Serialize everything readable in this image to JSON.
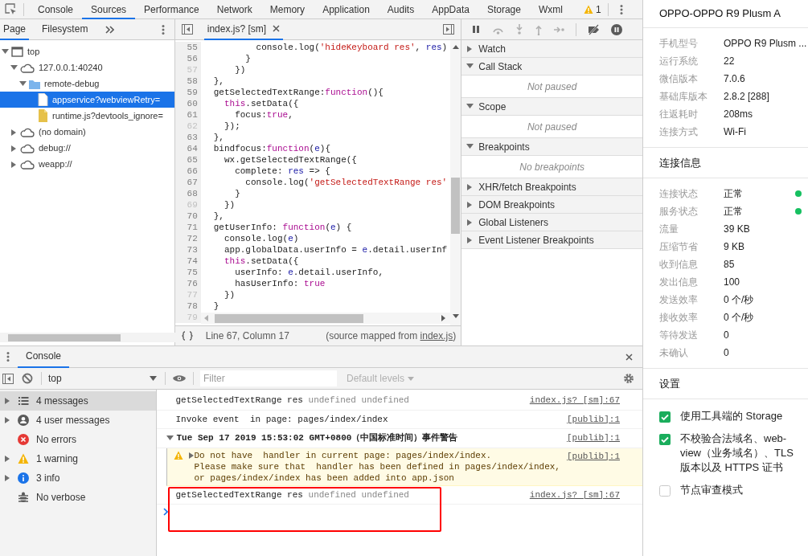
{
  "main_tabs": [
    {
      "label": "Console",
      "selected": false
    },
    {
      "label": "Sources",
      "selected": true
    },
    {
      "label": "Performance",
      "selected": false
    },
    {
      "label": "Network",
      "selected": false
    },
    {
      "label": "Memory",
      "selected": false
    },
    {
      "label": "Application",
      "selected": false
    },
    {
      "label": "Audits",
      "selected": false
    },
    {
      "label": "AppData",
      "selected": false
    },
    {
      "label": "Storage",
      "selected": false
    },
    {
      "label": "Wxml",
      "selected": false
    }
  ],
  "warning_count": "1",
  "navigator": {
    "tabs": [
      {
        "label": "Page",
        "selected": true
      },
      {
        "label": "Filesystem",
        "selected": false
      }
    ],
    "tree": [
      {
        "label": "top",
        "kind": "frame",
        "expanded": true,
        "selected": false,
        "children": [
          {
            "label": "127.0.0.1:40240",
            "kind": "domain",
            "expanded": true,
            "selected": false,
            "children": [
              {
                "label": "remote-debug",
                "kind": "folder",
                "expanded": true,
                "selected": false,
                "children": [
                  {
                    "label": "appservice?webviewRetry=",
                    "kind": "file",
                    "selected": true
                  },
                  {
                    "label": "runtime.js?devtools_ignore=",
                    "kind": "script",
                    "selected": false
                  }
                ]
              }
            ]
          },
          {
            "label": "(no domain)",
            "kind": "domain",
            "expanded": false,
            "selected": false
          },
          {
            "label": "debug://",
            "kind": "domain",
            "expanded": false,
            "selected": false
          },
          {
            "label": "weapp://",
            "kind": "domain",
            "expanded": false,
            "selected": false
          }
        ]
      }
    ]
  },
  "editor": {
    "tab": "index.js? [sm]",
    "lines": [
      {
        "number": "55",
        "dim": false,
        "code": [
          {
            "text": "        console.log(",
            "kind": "plain"
          },
          {
            "text": "'hideKeyboard res'",
            "kind": "string"
          },
          {
            "text": ", ",
            "kind": "plain"
          },
          {
            "text": "res",
            "kind": "variable"
          },
          {
            "text": ")",
            "kind": "plain"
          }
        ]
      },
      {
        "number": "56",
        "dim": false,
        "code": [
          {
            "text": "      }",
            "kind": "plain"
          }
        ]
      },
      {
        "number": "57",
        "dim": true,
        "code": [
          {
            "text": "    })",
            "kind": "plain"
          }
        ]
      },
      {
        "number": "58",
        "dim": false,
        "code": [
          {
            "text": "},",
            "kind": "plain"
          }
        ]
      },
      {
        "number": "59",
        "dim": false,
        "code": [
          {
            "text": "getSelectedTextRange:",
            "kind": "plain"
          },
          {
            "text": "function",
            "kind": "keyword"
          },
          {
            "text": "(){",
            "kind": "plain"
          }
        ]
      },
      {
        "number": "60",
        "dim": false,
        "code": [
          {
            "text": "  this",
            "kind": "keyword"
          },
          {
            "text": ".setData({",
            "kind": "plain"
          }
        ]
      },
      {
        "number": "61",
        "dim": false,
        "code": [
          {
            "text": "    focus:",
            "kind": "plain"
          },
          {
            "text": "true",
            "kind": "keyword"
          },
          {
            "text": ",",
            "kind": "plain"
          }
        ]
      },
      {
        "number": "62",
        "dim": true,
        "code": [
          {
            "text": "  });",
            "kind": "plain"
          }
        ]
      },
      {
        "number": "63",
        "dim": false,
        "code": [
          {
            "text": "},",
            "kind": "plain"
          }
        ]
      },
      {
        "number": "64",
        "dim": false,
        "code": [
          {
            "text": "bindfocus:",
            "kind": "plain"
          },
          {
            "text": "function",
            "kind": "keyword"
          },
          {
            "text": "(",
            "kind": "plain"
          },
          {
            "text": "e",
            "kind": "variable"
          },
          {
            "text": "){",
            "kind": "plain"
          }
        ]
      },
      {
        "number": "65",
        "dim": false,
        "code": [
          {
            "text": "  wx.getSelectedTextRange({",
            "kind": "plain"
          }
        ]
      },
      {
        "number": "66",
        "dim": false,
        "code": [
          {
            "text": "    complete: ",
            "kind": "plain"
          },
          {
            "text": "res",
            "kind": "variable"
          },
          {
            "text": " => {",
            "kind": "plain"
          }
        ]
      },
      {
        "number": "67",
        "dim": false,
        "code": [
          {
            "text": "      console.log(",
            "kind": "plain"
          },
          {
            "text": "'getSelectedTextRange res'",
            "kind": "string"
          }
        ]
      },
      {
        "number": "68",
        "dim": false,
        "code": [
          {
            "text": "    }",
            "kind": "plain"
          }
        ]
      },
      {
        "number": "69",
        "dim": true,
        "code": [
          {
            "text": "  })",
            "kind": "plain"
          }
        ]
      },
      {
        "number": "70",
        "dim": false,
        "code": [
          {
            "text": "},",
            "kind": "plain"
          }
        ]
      },
      {
        "number": "71",
        "dim": false,
        "code": [
          {
            "text": "getUserInfo: ",
            "kind": "plain"
          },
          {
            "text": "function",
            "kind": "keyword"
          },
          {
            "text": "(",
            "kind": "plain"
          },
          {
            "text": "e",
            "kind": "variable"
          },
          {
            "text": ") {",
            "kind": "plain"
          }
        ]
      },
      {
        "number": "72",
        "dim": false,
        "code": [
          {
            "text": "  console.log(",
            "kind": "plain"
          },
          {
            "text": "e",
            "kind": "variable"
          },
          {
            "text": ")",
            "kind": "plain"
          }
        ]
      },
      {
        "number": "73",
        "dim": false,
        "code": [
          {
            "text": "  app.globalData.userInfo = ",
            "kind": "plain"
          },
          {
            "text": "e",
            "kind": "variable"
          },
          {
            "text": ".detail.userInf",
            "kind": "plain"
          }
        ]
      },
      {
        "number": "74",
        "dim": false,
        "code": [
          {
            "text": "  this",
            "kind": "keyword"
          },
          {
            "text": ".setData({",
            "kind": "plain"
          }
        ]
      },
      {
        "number": "75",
        "dim": false,
        "code": [
          {
            "text": "    userInfo: ",
            "kind": "plain"
          },
          {
            "text": "e",
            "kind": "variable"
          },
          {
            "text": ".detail.userInfo,",
            "kind": "plain"
          }
        ]
      },
      {
        "number": "76",
        "dim": false,
        "code": [
          {
            "text": "    hasUserInfo: ",
            "kind": "plain"
          },
          {
            "text": "true",
            "kind": "keyword"
          }
        ]
      },
      {
        "number": "77",
        "dim": true,
        "code": [
          {
            "text": "  })",
            "kind": "plain"
          }
        ]
      },
      {
        "number": "78",
        "dim": false,
        "code": [
          {
            "text": "}",
            "kind": "plain"
          }
        ]
      },
      {
        "number": "79",
        "dim": true
      }
    ],
    "position": "Line 67, Column 17",
    "source_map": {
      "before": "(source mapped from ",
      "link": "index.js",
      "after": ")"
    }
  },
  "debugger": {
    "sections": [
      {
        "title": "Watch",
        "expanded": false
      },
      {
        "title": "Call Stack",
        "expanded": true,
        "empty_text": "Not paused"
      },
      {
        "title": "Scope",
        "expanded": true,
        "empty_text": "Not paused"
      },
      {
        "title": "Breakpoints",
        "expanded": true,
        "empty_text": "No breakpoints"
      },
      {
        "title": "XHR/fetch Breakpoints",
        "expanded": false
      },
      {
        "title": "DOM Breakpoints",
        "expanded": false
      },
      {
        "title": "Global Listeners",
        "expanded": false
      },
      {
        "title": "Event Listener Breakpoints",
        "expanded": false
      }
    ]
  },
  "console": {
    "tab": "Console",
    "context": "top",
    "filter_placeholder": "Filter",
    "levels": "Default levels",
    "sidebar": [
      {
        "label": "4 messages",
        "kind": "list",
        "has_arrow": true,
        "selected": true
      },
      {
        "label": "4 user messages",
        "kind": "user",
        "has_arrow": true,
        "selected": false
      },
      {
        "label": "No errors",
        "kind": "error",
        "has_arrow": false,
        "selected": false
      },
      {
        "label": "1 warning",
        "kind": "warning",
        "has_arrow": true,
        "selected": false
      },
      {
        "label": "3 info",
        "kind": "info",
        "has_arrow": true,
        "selected": false
      },
      {
        "label": "No verbose",
        "kind": "verbose",
        "has_arrow": false,
        "selected": false
      }
    ],
    "messages": [
      {
        "kind": "log",
        "text": "getSelectedTextRange res",
        "args": "undefined undefined",
        "source": "index.js? [sm]:67",
        "highlighted": false
      },
      {
        "kind": "log",
        "text": "Invoke event  in page: pages/index/index",
        "source": "[publib]:1",
        "highlighted": false
      },
      {
        "kind": "group",
        "text": "Tue Sep 17 2019 15:53:02 GMT+0800（中国标准时间）事件警告",
        "source": "[publib]:1",
        "highlighted": false
      },
      {
        "kind": "warning",
        "text": "Do not have  handler in current page: pages/index/index.\nPlease make sure that  handler has been defined in pages/index/index,\nor pages/index/index has been added into app.json",
        "source": "[publib]:1",
        "highlighted": false
      },
      {
        "kind": "log",
        "text": "getSelectedTextRange res",
        "args": "undefined undefined",
        "source": "index.js? [sm]:67",
        "highlighted": true
      }
    ]
  },
  "device_panel": {
    "title": "OPPO-OPPO R9 Plusm A",
    "device_info": [
      {
        "label": "手机型号",
        "value": "OPPO R9 Plusm ..."
      },
      {
        "label": "运行系统",
        "value": "22"
      },
      {
        "label": "微信版本",
        "value": "7.0.6"
      },
      {
        "label": "基础库版本",
        "value": "2.8.2 [288]"
      },
      {
        "label": "往返耗时",
        "value": "208ms"
      },
      {
        "label": "连接方式",
        "value": "Wi-Fi"
      }
    ],
    "connection_title": "连接信息",
    "connection": [
      {
        "label": "连接状态",
        "value": "正常",
        "color": "#16c060"
      },
      {
        "label": "服务状态",
        "value": "正常",
        "color": "#16c060"
      },
      {
        "label": "流量",
        "value": "39 KB"
      },
      {
        "label": "压缩节省",
        "value": "9 KB"
      },
      {
        "label": "收到信息",
        "value": "85"
      },
      {
        "label": "发出信息",
        "value": "100"
      },
      {
        "label": "发送效率",
        "value": "0 个/秒"
      },
      {
        "label": "接收效率",
        "value": "0 个/秒"
      },
      {
        "label": "等待发送",
        "value": "0"
      },
      {
        "label": "未确认",
        "value": "0"
      }
    ],
    "settings_title": "设置",
    "settings": [
      {
        "label": "使用工具端的 Storage",
        "checked": true
      },
      {
        "label": "不校验合法域名、web-view（业务域名）、TLS 版本以及 HTTPS 证书",
        "checked": true
      },
      {
        "label": "节点审查模式",
        "checked": false
      }
    ]
  }
}
